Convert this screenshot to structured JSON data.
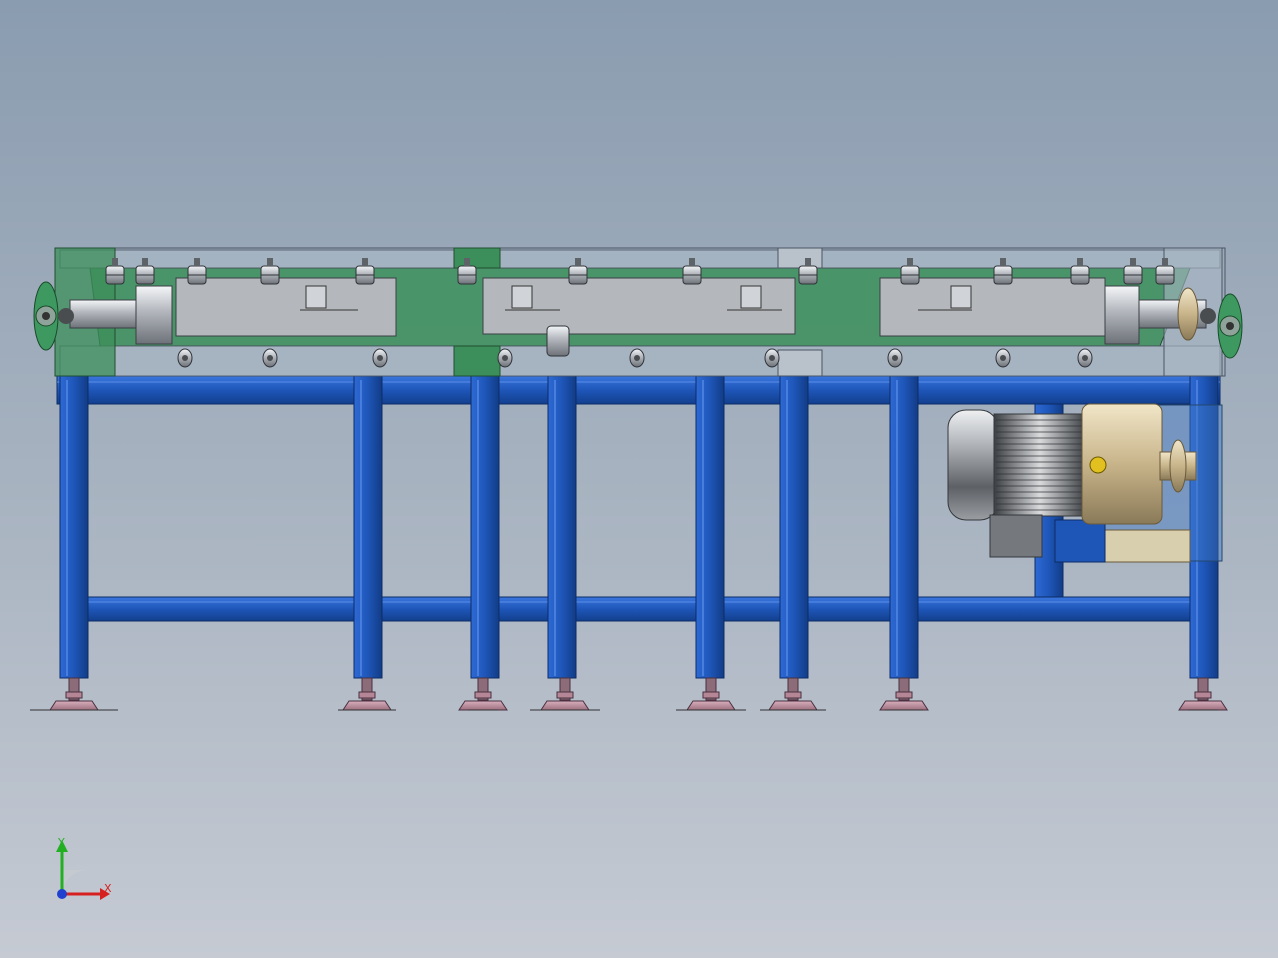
{
  "viewport": {
    "background_top": "#8a9cb0",
    "background_bottom": "#c5cad3"
  },
  "model": {
    "frame_color": "#1e56b8",
    "frame_dark": "#143f8c",
    "belt_color": "#3c8f5a",
    "guard_color": "#b4b8bd",
    "foot_color": "#c89aa8",
    "motor_color": "#b9bdc2"
  },
  "triad": {
    "y_label": "Y",
    "x_label": "X",
    "icons": [
      "y-axis-arrow",
      "x-axis-arrow",
      "z-axis-origin"
    ],
    "colors": {
      "x": "#d62020",
      "y": "#22b022",
      "z": "#2040d0"
    }
  }
}
